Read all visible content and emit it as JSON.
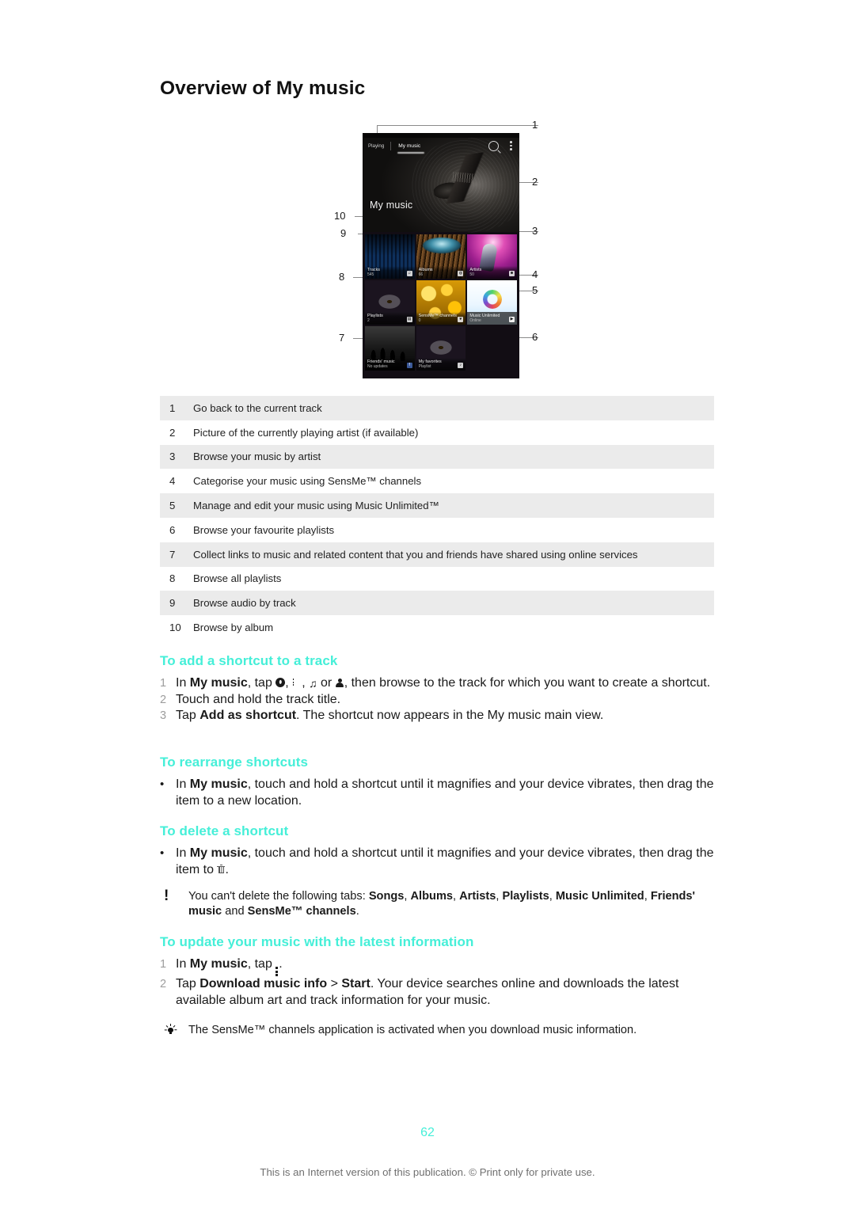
{
  "document": {
    "title": "Overview of My music",
    "page_number": "62",
    "footer": "This is an Internet version of this publication. © Print only for private use."
  },
  "figure": {
    "phone": {
      "tabs": {
        "playing": "Playing",
        "my_music": "My music"
      },
      "icons": {
        "search": "search-icon",
        "overflow": "overflow-menu-icon"
      },
      "hero_label": "My music",
      "tiles": [
        {
          "title": "Tracks",
          "sub": "545",
          "badge": "♫"
        },
        {
          "title": "Albums",
          "sub": "66",
          "badge": "◍"
        },
        {
          "title": "Artists",
          "sub": "50",
          "badge": "☻"
        },
        {
          "title": "Playlists",
          "sub": "2",
          "badge": "▤"
        },
        {
          "title": "SensMe™ channels",
          "sub": "0",
          "badge": "❦"
        },
        {
          "title": "Music Unlimited",
          "sub": "Online",
          "badge": "▶"
        },
        {
          "title": "Friends' music",
          "sub": "No updates",
          "badge": "f"
        },
        {
          "title": "My favorites",
          "sub": "Playlist",
          "badge": "♪"
        }
      ]
    },
    "callouts": [
      "1",
      "2",
      "3",
      "4",
      "5",
      "6",
      "7",
      "8",
      "9",
      "10"
    ]
  },
  "reference_table": {
    "rows": [
      {
        "num": "1",
        "text": "Go back to the current track"
      },
      {
        "num": "2",
        "text": "Picture of the currently playing artist (if available)"
      },
      {
        "num": "3",
        "text": "Browse your music by artist"
      },
      {
        "num": "4",
        "text": "Categorise your music using SensMe™ channels"
      },
      {
        "num": "5",
        "text": "Manage and edit your music using Music Unlimited™"
      },
      {
        "num": "6",
        "text": "Browse your favourite playlists"
      },
      {
        "num": "7",
        "text": "Collect links to music and related content that you and friends have shared using online services"
      },
      {
        "num": "8",
        "text": "Browse all playlists"
      },
      {
        "num": "9",
        "text": "Browse audio by track"
      },
      {
        "num": "10",
        "text": "Browse by album"
      }
    ]
  },
  "sections": {
    "add_shortcut": {
      "heading": "To add a shortcut to a track",
      "steps": {
        "one_num": "1",
        "one_a": "In ",
        "one_b": "My music",
        "one_c": ", tap ",
        "one_d": ", ",
        "one_e": ", ",
        "one_f": " or ",
        "one_g": ", then browse to the track for which you want to create a shortcut.",
        "two_num": "2",
        "two_text": "Touch and hold the track title.",
        "three_num": "3",
        "three_a": "Tap ",
        "three_b": "Add as shortcut",
        "three_c": ". The shortcut now appears in the My music main view."
      }
    },
    "rearrange": {
      "heading": "To rearrange shortcuts",
      "bullet": "•",
      "text_a": "In ",
      "text_b": "My music",
      "text_c": ", touch and hold a shortcut until it magnifies and your device vibrates, then drag the item to a new location."
    },
    "delete": {
      "heading": "To delete a shortcut",
      "bullet": "•",
      "text_a": "In ",
      "text_b": "My music",
      "text_c": ", touch and hold a shortcut until it magnifies and your device vibrates, then drag the item to ",
      "text_d": ".",
      "note": {
        "icon": "exclamation-icon",
        "a": "You can't delete the following tabs: ",
        "b1": "Songs",
        "s1": ", ",
        "b2": "Albums",
        "s2": ", ",
        "b3": "Artists",
        "s3": ", ",
        "b4": "Playlists",
        "s4": ", ",
        "b5": "Music Unlimited",
        "s5": ", ",
        "b6": "Friends' music",
        "s6": " and ",
        "b7": "SensMe™ channels",
        "s7": "."
      }
    },
    "update_music": {
      "heading": "To update your music with the latest information",
      "steps": {
        "one_num": "1",
        "one_a": "In ",
        "one_b": "My music",
        "one_c": ", tap ",
        "one_d": ".",
        "two_num": "2",
        "two_a": "Tap ",
        "two_b": "Download music info",
        "two_c": " > ",
        "two_d": "Start",
        "two_e": ". Your device searches online and downloads the latest available album art and track information for your music."
      },
      "tip": {
        "icon": "lightbulb-icon",
        "text": "The SensMe™ channels application is activated when you download music information."
      }
    }
  },
  "colors": {
    "accent": "#45efd8",
    "table_shade": "#ebebeb",
    "body_text": "#1a1a1a",
    "muted": "#6f6f6f"
  }
}
